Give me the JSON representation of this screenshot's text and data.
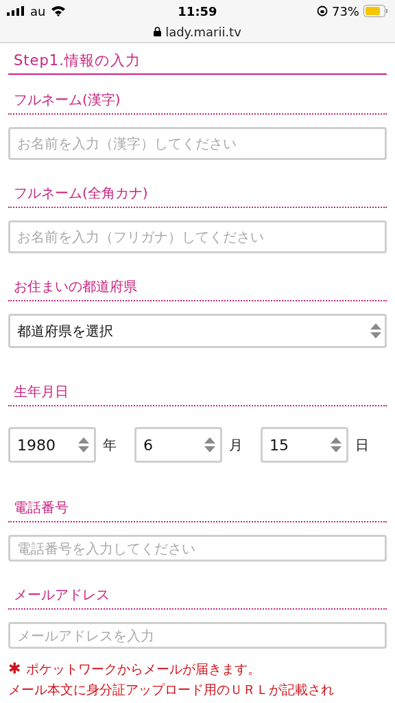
{
  "status_bar": {
    "carrier": "au",
    "time": "11:59",
    "battery": "73%"
  },
  "address_bar": {
    "url": "lady.marii.tv"
  },
  "heading": "Step1.情報の入力",
  "fields": [
    {
      "kind": "text",
      "label": "フルネーム(漢字)",
      "placeholder": "お名前を入力（漢字）してください"
    },
    {
      "kind": "text",
      "label": "フルネーム(全角カナ)",
      "placeholder": "お名前を入力（フリガナ）してください"
    },
    {
      "kind": "select",
      "label": "お住まいの都道府県",
      "value": "都道府県を選択"
    },
    {
      "kind": "date",
      "label": "生年月日",
      "parts": [
        {
          "value": "1980",
          "unit": "年"
        },
        {
          "value": "6",
          "unit": "月"
        },
        {
          "value": "15",
          "unit": "日"
        }
      ]
    },
    {
      "kind": "slim",
      "label": "電話番号",
      "placeholder": "電話番号を入力してください"
    },
    {
      "kind": "slim",
      "label": "メールアドレス",
      "placeholder": "メールアドレスを入力"
    }
  ],
  "note": {
    "mark": "✱",
    "lines": [
      "ポケットワークからメールが届きます。",
      "メール本文に身分証アップロード用のＵＲＬが記載され"
    ]
  }
}
